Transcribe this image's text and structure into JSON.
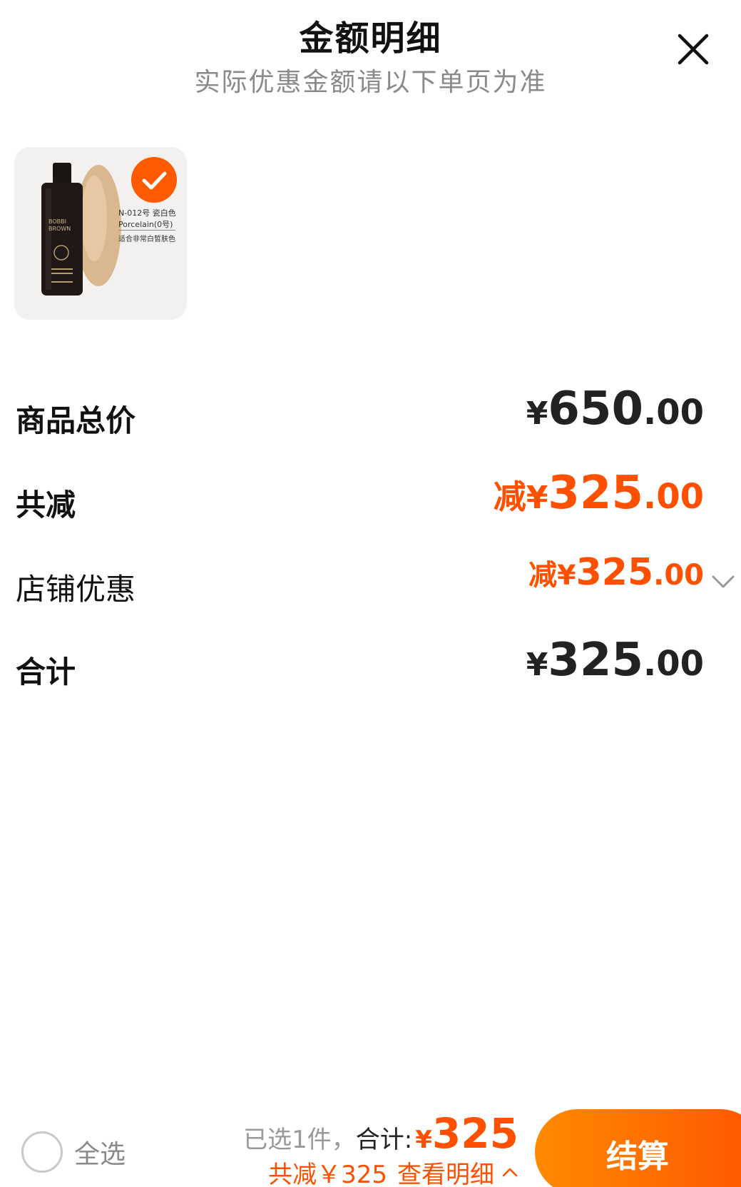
{
  "header": {
    "title": "金额明细",
    "subtitle": "实际优惠金额请以下单页为准"
  },
  "product": {
    "shade_code": "N-012号 瓷白色",
    "shade_name": "Porcelain(0号)",
    "shade_note": "适合非常白皙肤色",
    "brand": "BOBBI BROWN",
    "selected": true
  },
  "rows": [
    {
      "label": "商品总价",
      "prefix": "",
      "currency": "¥",
      "int": "650",
      "dec": ".00"
    },
    {
      "label": "共减",
      "prefix": "减",
      "currency": "¥",
      "int": "325",
      "dec": ".00"
    },
    {
      "label": "店铺优惠",
      "prefix": "减",
      "currency": "¥",
      "int": "325",
      "dec": ".00"
    },
    {
      "label": "合计",
      "prefix": "",
      "currency": "¥",
      "int": "325",
      "dec": ".00"
    }
  ],
  "bottom": {
    "select_all": "全选",
    "selected_count": "已选1件，",
    "total_label": "合计:",
    "total_currency": "¥",
    "total_value": "325",
    "discount_text": "共减￥325",
    "view_detail": "查看明细",
    "checkout_label": "结算"
  },
  "colors": {
    "accent": "#ff5000",
    "checkout_start": "#ff8a00",
    "checkout_end": "#ff5500"
  }
}
